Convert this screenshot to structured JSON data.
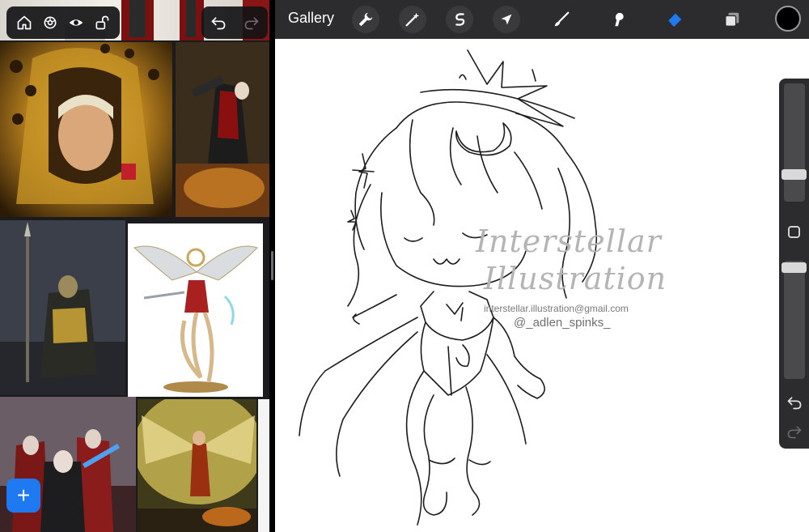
{
  "app": {
    "gallery_label": "Gallery"
  },
  "toolbar": {
    "left_icons": [
      "home-icon",
      "settings-icon",
      "eye-icon",
      "unlock-icon"
    ],
    "undo_icons": [
      "undo-icon",
      "redo-icon"
    ],
    "tools": [
      "wrench-icon",
      "magic-wand-icon",
      "selection-icon",
      "arrow-cursor-icon",
      "brush-icon",
      "smudge-icon",
      "eraser-icon",
      "layers-icon"
    ],
    "active_tool": "eraser",
    "current_color": "#000000"
  },
  "reference_panel": {
    "add_label": "+",
    "images": [
      "golden-armored-knight",
      "battle-sister-with-gun",
      "armored-warrior-with-spear",
      "winged-angel-miniature",
      "sisters-group",
      "golden-winged-angel"
    ]
  },
  "watermark": {
    "brand_line_1": "Interstellar",
    "brand_line_2": "Illustration",
    "email": "interstellar.illustration@gmail.com",
    "handle": "@_adlen_spinks_"
  },
  "side_panel": {
    "brush_size": 0.21,
    "opacity": 0.07
  },
  "colors": {
    "accent": "#1f7af2",
    "topbar": "#2c2c2e",
    "canvas": "#ffffff"
  }
}
